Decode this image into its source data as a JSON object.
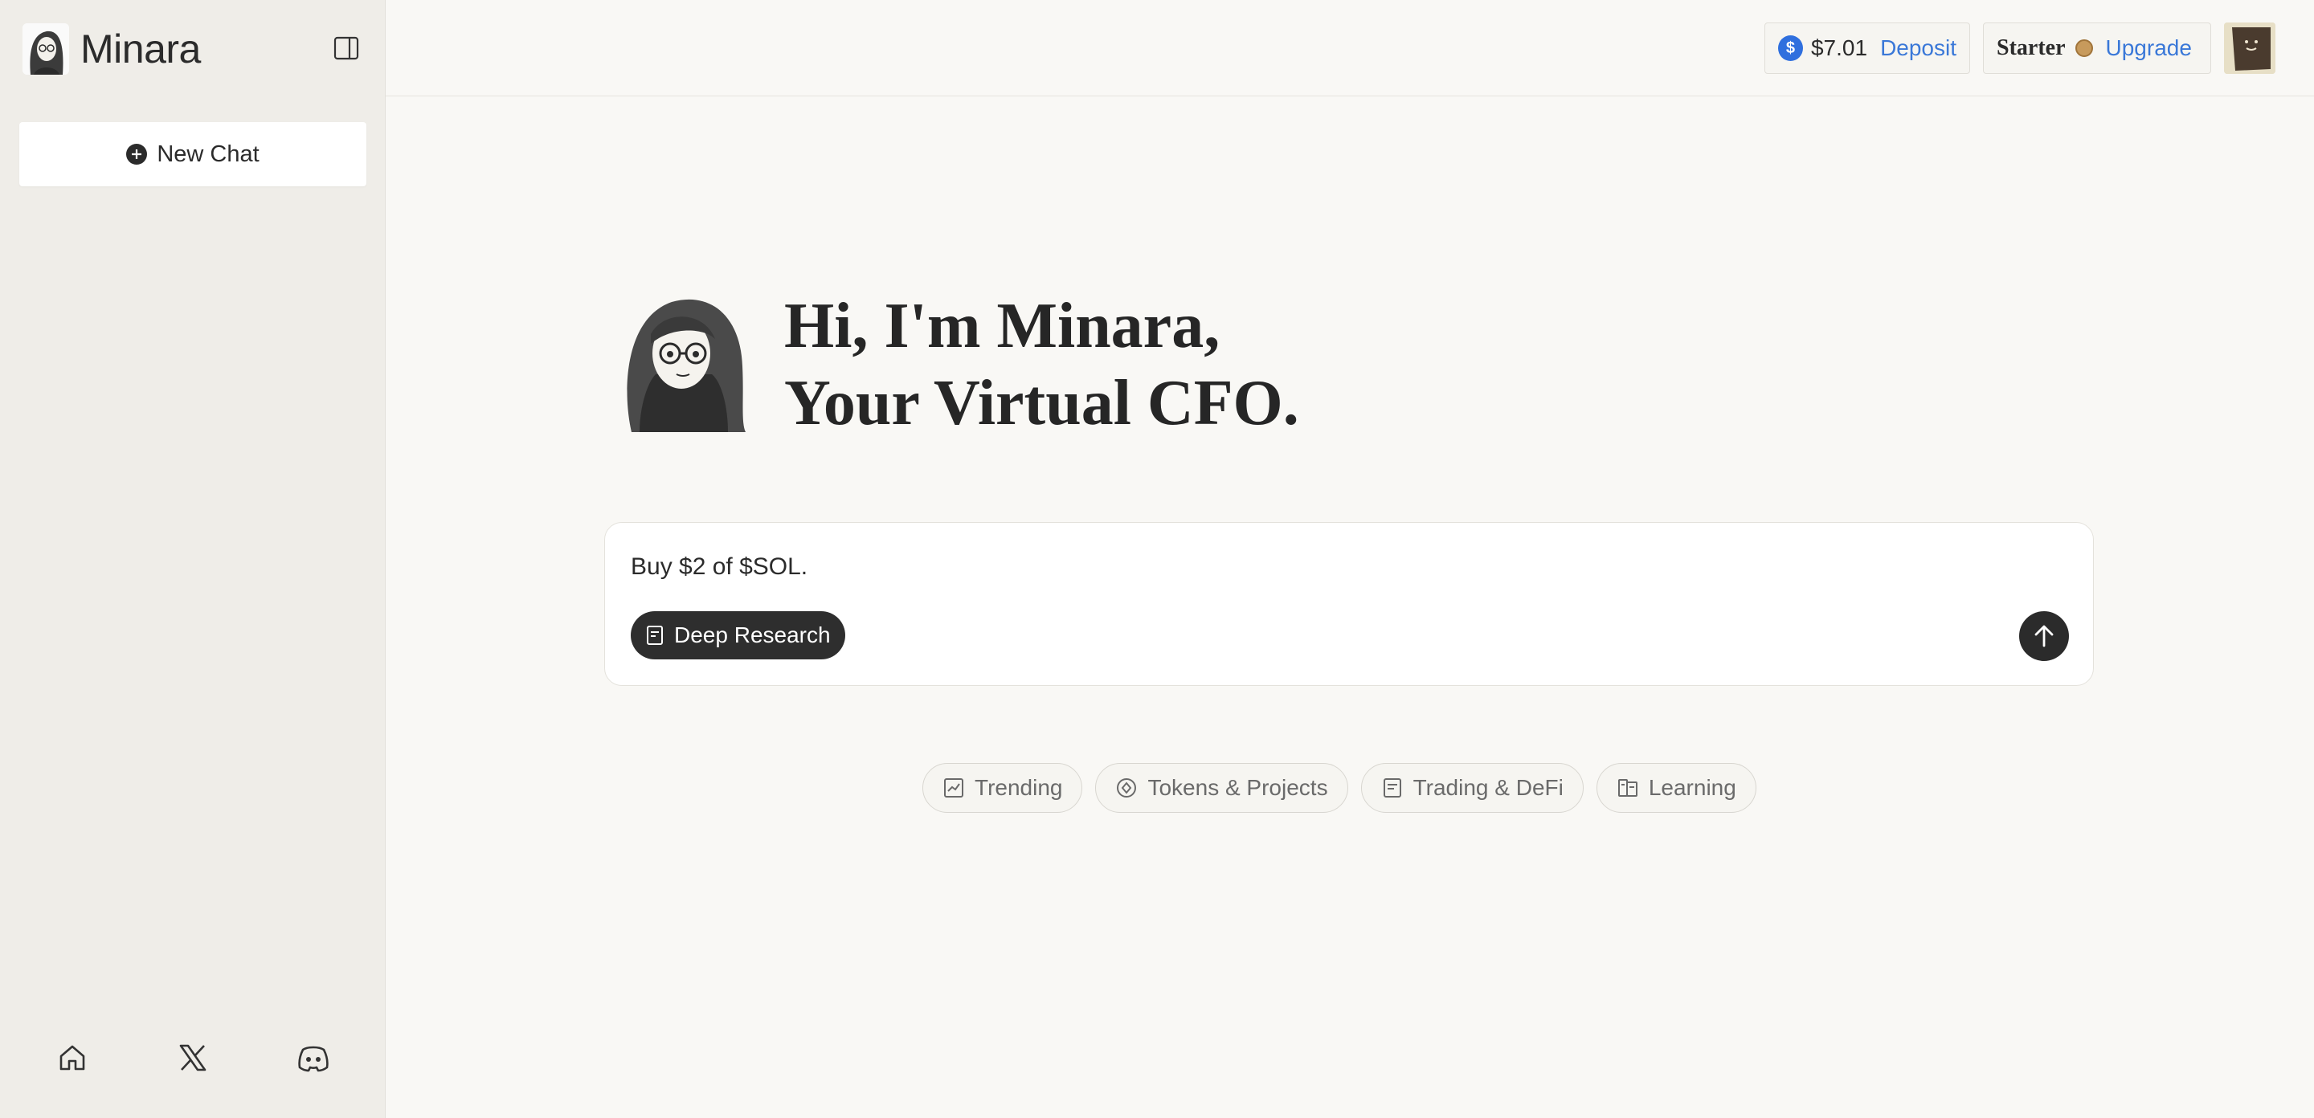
{
  "sidebar": {
    "app_name": "Minara",
    "new_chat_label": "New Chat",
    "footer_icons": [
      "home-icon",
      "x-logo-icon",
      "discord-icon"
    ]
  },
  "topbar": {
    "balance": "$7.01",
    "deposit_label": "Deposit",
    "plan_name": "Starter",
    "upgrade_label": "Upgrade"
  },
  "hero": {
    "line1": "Hi, I'm Minara,",
    "line2": "Your Virtual CFO."
  },
  "composer": {
    "text": "Buy $2 of $SOL.",
    "deep_research_label": "Deep Research"
  },
  "chips": [
    {
      "label": "Trending",
      "icon": "chart-icon"
    },
    {
      "label": "Tokens & Projects",
      "icon": "token-icon"
    },
    {
      "label": "Trading & DeFi",
      "icon": "document-icon"
    },
    {
      "label": "Learning",
      "icon": "book-icon"
    }
  ],
  "colors": {
    "accent_link": "#3a78d8",
    "sidebar_bg": "#efede8",
    "main_bg": "#f9f8f5",
    "dark": "#2b2b2b"
  }
}
